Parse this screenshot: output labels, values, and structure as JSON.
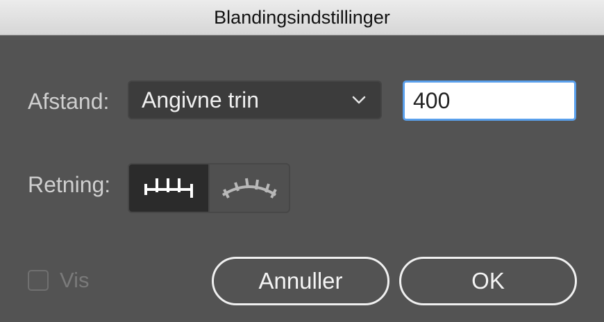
{
  "dialog": {
    "title": "Blandingsindstillinger"
  },
  "spacing": {
    "label": "Afstand:",
    "selected": "Angivne trin",
    "value": "400"
  },
  "orientation": {
    "label": "Retning:",
    "options": [
      {
        "icon": "align-to-page-icon",
        "selected": true
      },
      {
        "icon": "align-to-path-icon",
        "selected": false
      }
    ]
  },
  "preview": {
    "label": "Vis",
    "checked": false
  },
  "buttons": {
    "cancel": "Annuller",
    "ok": "OK"
  },
  "colors": {
    "background": "#535353",
    "focus_ring": "#5aa0ec",
    "titlebar": "#e0e0e0"
  }
}
